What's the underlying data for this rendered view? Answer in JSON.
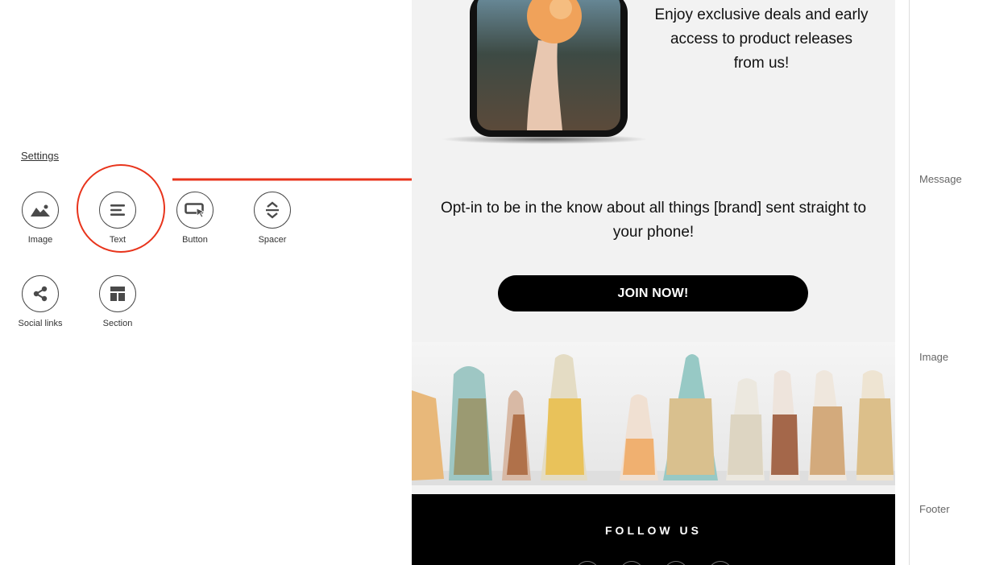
{
  "left_panel": {
    "settings_label": "Settings",
    "blocks": [
      {
        "label": "Image",
        "icon": "image-icon"
      },
      {
        "label": "Text",
        "icon": "text-icon"
      },
      {
        "label": "Button",
        "icon": "button-icon"
      },
      {
        "label": "Spacer",
        "icon": "spacer-icon"
      },
      {
        "label": "Social links",
        "icon": "share-icon"
      },
      {
        "label": "Section",
        "icon": "section-icon"
      }
    ],
    "highlight_color": "#e8341c"
  },
  "email": {
    "hero_text": "Enjoy exclusive deals and early access to product releases from us!",
    "optin_text": "Opt-in to be in the know about all things [brand] sent straight to your phone!",
    "cta_label": "JOIN NOW!",
    "footer_heading": "FOLLOW US",
    "background_color": "#f2f2f2",
    "footer_color": "#000000"
  },
  "right_panel": {
    "sections": [
      "Message",
      "Image",
      "Footer"
    ]
  }
}
